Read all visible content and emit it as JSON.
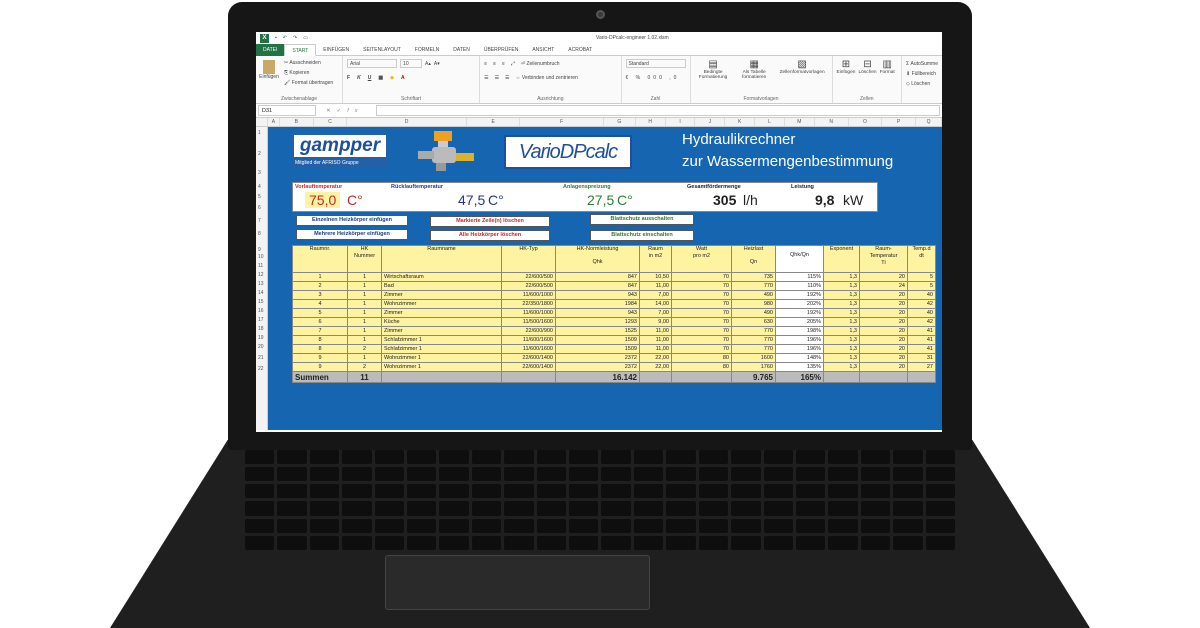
{
  "window": {
    "title": "Vario-DPcalc-engineer 1.02.xlsm"
  },
  "tabs": [
    "DATEI",
    "START",
    "EINFÜGEN",
    "SEITENLAYOUT",
    "FORMELN",
    "DATEN",
    "ÜBERPRÜFEN",
    "ANSICHT",
    "ACROBAT"
  ],
  "ribbon": {
    "paste": "Einfügen",
    "cut": "Ausschneiden",
    "copy": "Kopieren",
    "format_painter": "Format übertragen",
    "clipboard": "Zwischenablage",
    "font_name": "Arial",
    "font_size": "10",
    "font_group": "Schriftart",
    "wrap": "Zeilenumbruch",
    "merge": "Verbinden und zentrieren",
    "alignment": "Ausrichtung",
    "number_format": "Standard",
    "number": "Zahl",
    "cond_format": "Bedingte Formatierung",
    "as_table": "Als Tabelle formatieren",
    "cell_styles": "Zellenformatvorlagen",
    "styles": "Formatvorlagen",
    "insert": "Einfügen",
    "delete": "Löschen",
    "format": "Format",
    "cells": "Zellen",
    "autosum": "AutoSumme",
    "fill": "Füllbereich",
    "clear": "Löschen"
  },
  "formula_bar": {
    "name_box": "D31",
    "fx": "fx"
  },
  "columns": [
    "A",
    "B",
    "C",
    "D",
    "E",
    "F",
    "G",
    "H",
    "I",
    "J",
    "K",
    "L",
    "M",
    "N",
    "O",
    "P",
    "Q"
  ],
  "rows": [
    "1",
    "2",
    "3",
    "4",
    "5",
    "6",
    "7",
    "8",
    "9",
    "10",
    "11",
    "12",
    "13",
    "14",
    "15",
    "16",
    "17",
    "18",
    "19",
    "20",
    "21",
    "22"
  ],
  "header": {
    "logo_gampper": "gampper",
    "logo_sub": "Mitglied der AFRISO Gruppe",
    "logo_vario": "VarioDPcalc",
    "title_line1": "Hydraulikrechner",
    "title_line2": "zur Wassermengenbestimmung"
  },
  "params": {
    "vorlauf_label": "Vorlauftemperatur",
    "vorlauf_value": "75,0",
    "vorlauf_unit": "C°",
    "ruecklauf_label": "Rücklauftemperatur",
    "ruecklauf_value": "47,5",
    "ruecklauf_unit": "C°",
    "spreizung_label": "Anlagenspreizung",
    "spreizung_value": "27,5",
    "spreizung_unit": "C°",
    "foerder_label": "Gesamtfördermenge",
    "foerder_value": "305",
    "foerder_unit": "l/h",
    "leistung_label": "Leistung",
    "leistung_value": "9,8",
    "leistung_unit": "kW",
    "colors": {
      "vorlauf": "#c62828",
      "ruecklauf": "#283593",
      "spreizung": "#2e7d32"
    }
  },
  "buttons": {
    "insert_single": "Einzelnen Heizkörper einfügen",
    "insert_multi": "Mehrere Heizkörper einfügen",
    "delete_marked": "Markierte Zeile(n) löschen",
    "delete_all": "Alle Heizkörper löschen",
    "protect_off": "Blattschutz ausschalten",
    "protect_on": "Blattschutz einschalten"
  },
  "table": {
    "headers": [
      [
        "Raumnr.",
        ""
      ],
      [
        "HK",
        "Nummer"
      ],
      [
        "Raumname",
        ""
      ],
      [
        "HK-Typ",
        ""
      ],
      [
        "HK-Normleistung",
        "Qhk"
      ],
      [
        "Raum",
        "in m2"
      ],
      [
        "Watt",
        "pro m2"
      ],
      [
        "Heizlast",
        "Qn"
      ],
      [
        "",
        "Qhk/Qn"
      ],
      [
        "Exponent",
        ""
      ],
      [
        "Raum-",
        "Temperatur",
        "Ti"
      ],
      [
        "Temp.d",
        "dt"
      ]
    ],
    "rows": [
      [
        "1",
        "1",
        "Wirtschaftsraum",
        "22/600/500",
        "847",
        "10,50",
        "70",
        "735",
        "115%",
        "1,3",
        "20",
        "5"
      ],
      [
        "2",
        "1",
        "Bad",
        "22/600/500",
        "847",
        "11,00",
        "70",
        "770",
        "110%",
        "1,3",
        "24",
        "5"
      ],
      [
        "3",
        "1",
        "Zimmer",
        "11/600/1000",
        "943",
        "7,00",
        "70",
        "490",
        "192%",
        "1,3",
        "20",
        "40"
      ],
      [
        "4",
        "1",
        "Wohnzimmer",
        "22/350/1800",
        "1984",
        "14,00",
        "70",
        "980",
        "202%",
        "1,3",
        "20",
        "42"
      ],
      [
        "5",
        "1",
        "Zimmer",
        "11/600/1000",
        "943",
        "7,00",
        "70",
        "490",
        "192%",
        "1,3",
        "20",
        "40"
      ],
      [
        "6",
        "1",
        "Küche",
        "11/500/1600",
        "1293",
        "9,00",
        "70",
        "630",
        "205%",
        "1,3",
        "20",
        "42"
      ],
      [
        "7",
        "1",
        "Zimmer",
        "22/600/900",
        "1525",
        "11,00",
        "70",
        "770",
        "198%",
        "1,3",
        "20",
        "41"
      ],
      [
        "8",
        "1",
        "Schlafzimmer 1",
        "11/600/1600",
        "1509",
        "11,00",
        "70",
        "770",
        "196%",
        "1,3",
        "20",
        "41"
      ],
      [
        "8",
        "2",
        "Schlafzimmer 1",
        "11/600/1600",
        "1509",
        "11,00",
        "70",
        "770",
        "196%",
        "1,3",
        "20",
        "41"
      ],
      [
        "9",
        "1",
        "Wohnzimmer 1",
        "22/600/1400",
        "2372",
        "22,00",
        "80",
        "1600",
        "148%",
        "1,3",
        "20",
        "31"
      ],
      [
        "9",
        "2",
        "Wohnzimmer 1",
        "22/600/1400",
        "2372",
        "22,00",
        "80",
        "1760",
        "135%",
        "1,3",
        "20",
        "27"
      ]
    ],
    "sum_label": "Summen",
    "sum_count": "11",
    "sum_qhk": "16.142",
    "sum_qn": "9.765",
    "sum_ratio": "165%"
  }
}
